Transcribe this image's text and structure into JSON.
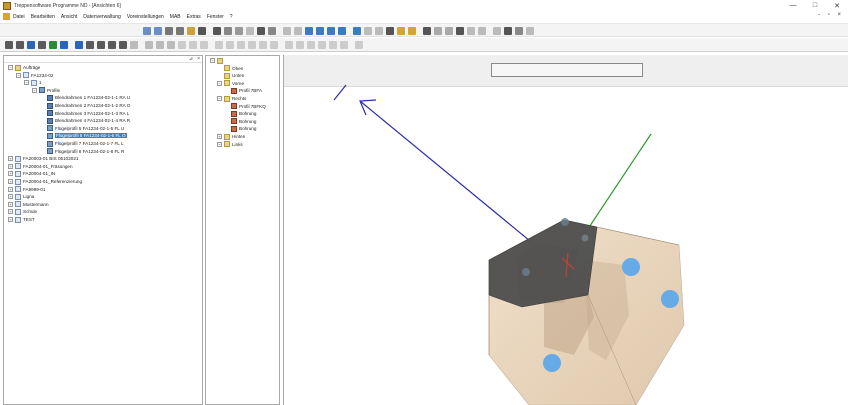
{
  "window": {
    "title": "Treppensoftware Programme ND - [Ansichten 6]",
    "controls": [
      "—",
      "□",
      "✕"
    ]
  },
  "menu": {
    "items": [
      "Datei",
      "Bearbeiten",
      "Ansicht",
      "Datenverwaltung",
      "Voreinstellungen",
      "MAB",
      "Extras",
      "Fenster",
      "?"
    ],
    "mdi_controls": "- ▫ ×"
  },
  "left_panel": {
    "header_controls": {
      "pin": "⊿",
      "close": "×"
    },
    "tree": [
      {
        "label": "Aufträge",
        "level": 0,
        "expander": "−",
        "icon": "folder"
      },
      {
        "label": "FA1234-02",
        "level": 1,
        "expander": "−",
        "icon": "doc"
      },
      {
        "label": "1",
        "level": 2,
        "expander": "−",
        "icon": "doc"
      },
      {
        "label": "Profile",
        "level": 3,
        "expander": "−",
        "icon": "profile"
      },
      {
        "label": "Blendrahmen   1 FA1234-02-1-1 RA  U",
        "level": 4,
        "icon": "frame"
      },
      {
        "label": "Blendrahmen   2 FA1234-02-1-2 RA  O",
        "level": 4,
        "icon": "frame"
      },
      {
        "label": "Blendrahmen   3 FA1234-02-1-3 RA  L",
        "level": 4,
        "icon": "frame"
      },
      {
        "label": "Blendrahmen   4 FA1234-02-1-4 RA  R",
        "level": 4,
        "icon": "frame"
      },
      {
        "label": "Flügelprofil   5 FA1234-02-1-5 FL  U",
        "level": 4,
        "icon": "profile"
      },
      {
        "label": "Flügelprofil   6 FA1234-02-1-6 FL  O",
        "level": 4,
        "icon": "profile",
        "selected": true
      },
      {
        "label": "Flügelprofil   7 FA1234-02-1-7 FL  L",
        "level": 4,
        "icon": "profile"
      },
      {
        "label": "Flügelprofil   8 FA1234-02-1-8 FL  R",
        "level": 4,
        "icon": "profile"
      },
      {
        "label": "FA20003-01 BIS 05102021",
        "level": 0,
        "expander": "+",
        "icon": "doc"
      },
      {
        "label": "FA20004-01_Fräsungen",
        "level": 0,
        "expander": "+",
        "icon": "doc"
      },
      {
        "label": "FA20004-01_IN",
        "level": 0,
        "expander": "+",
        "icon": "doc"
      },
      {
        "label": "FA20004-01_Referenzierung",
        "level": 0,
        "expander": "+",
        "icon": "doc"
      },
      {
        "label": "FA9999-01",
        "level": 0,
        "expander": "+",
        "icon": "doc"
      },
      {
        "label": "Ligna",
        "level": 0,
        "expander": "+",
        "icon": "doc"
      },
      {
        "label": "Mustermann",
        "level": 0,
        "expander": "+",
        "icon": "doc"
      },
      {
        "label": "Schule",
        "level": 0,
        "expander": "+",
        "icon": "doc"
      },
      {
        "label": "TEST",
        "level": 0,
        "expander": "+",
        "icon": "doc"
      }
    ]
  },
  "mid_panel": {
    "tree": [
      {
        "label": "",
        "level": 0,
        "expander": "−",
        "icon": "folder"
      },
      {
        "label": "Oben",
        "level": 1,
        "icon": "folder"
      },
      {
        "label": "Unten",
        "level": 1,
        "icon": "folder"
      },
      {
        "label": "Vorne",
        "level": 1,
        "expander": "−",
        "icon": "folder"
      },
      {
        "label": "Profil 7BFA",
        "level": 2,
        "icon": "part"
      },
      {
        "label": "Rechts",
        "level": 1,
        "expander": "−",
        "icon": "folder"
      },
      {
        "label": "Profil 7BFKQ",
        "level": 2,
        "icon": "part"
      },
      {
        "label": "Bohrung",
        "level": 2,
        "icon": "part"
      },
      {
        "label": "Bohrung",
        "level": 2,
        "icon": "part"
      },
      {
        "label": "Bohrung",
        "level": 2,
        "icon": "part"
      },
      {
        "label": "Hinten",
        "level": 1,
        "expander": "+",
        "icon": "folder"
      },
      {
        "label": "Links",
        "level": 1,
        "expander": "+",
        "icon": "folder"
      }
    ]
  },
  "viewport": {
    "colors": {
      "axis_blue": "#2e2ea6",
      "axis_green": "#2a9a2a",
      "block_face": "#e9d3b8",
      "block_top": "#4e4e4e",
      "holes": "#5aa7ea"
    }
  },
  "toolbar_icons": {
    "row1": [
      "#6b8ec7",
      "#6b8ec7",
      "#777",
      "#777",
      "#c9a23a",
      "#555",
      "#555",
      "#888",
      "#999",
      "#bbb",
      "#555",
      "#888",
      "#bbb",
      "#bbb",
      "#3a7bc8",
      "#3a7bc8",
      "#3a7bc8",
      "#3a7bc8",
      "#3a7bc8",
      "#bbb",
      "#bbb",
      "#555",
      "#d4a43a",
      "#d4a43a",
      "#555",
      "#aaa",
      "#aaa",
      "#555",
      "#bbb",
      "#bbb",
      "#bbb",
      "#555",
      "#888",
      "#bbb"
    ],
    "row2": [
      "#5a5a5a",
      "#5a5a5a",
      "#2a66b8",
      "#5a5a5a",
      "#2a8a3a",
      "#2a66b8",
      "#2a66b8",
      "#5a5a5a",
      "#5a5a5a",
      "#5a5a5a",
      "#5a5a5a",
      "#bbb",
      "#bbb",
      "#bbb",
      "#bbb",
      "#ccc",
      "#ccc",
      "#ccc",
      "#ccc",
      "#ccc",
      "#ccc",
      "#ccc",
      "#ccc",
      "#ccc",
      "#ccc",
      "#ccc",
      "#ccc",
      "#ccc",
      "#ccc",
      "#ccc",
      "#ccc"
    ]
  }
}
